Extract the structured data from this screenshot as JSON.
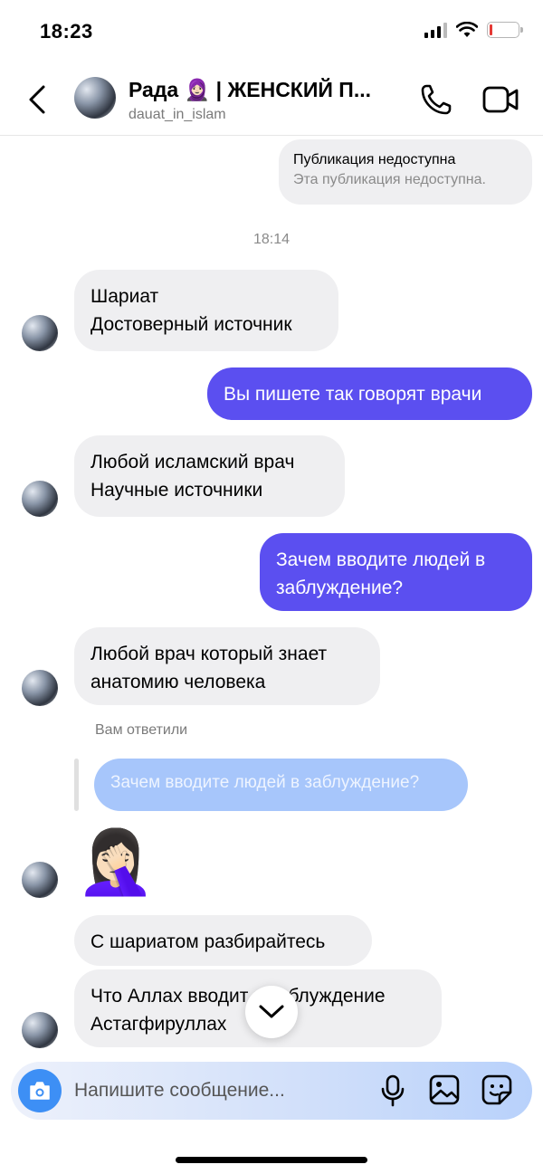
{
  "status_bar": {
    "time": "18:23"
  },
  "header": {
    "title": "Рада 🧕🏻 | ЖЕНСКИЙ П...",
    "subtitle": "dauat_in_islam"
  },
  "messages": {
    "publication": {
      "title": "Публикация недоступна",
      "subtitle": "Эта публикация недоступна."
    },
    "timestamp": "18:14",
    "m1": {
      "line1": "Шариат",
      "line2": "Достоверный источник"
    },
    "m2": {
      "line1": "Вы пишете так говорят врачи"
    },
    "m3": {
      "line1": "Любой исламский врач",
      "line2": "Научные источники"
    },
    "m4": {
      "line1": "Зачем вводите людей в",
      "line2": "заблуждение?"
    },
    "m5": {
      "line1": "Любой врач который знает",
      "line2": "анатомию человека"
    },
    "reply_note": "Вам ответили",
    "reply_quote": "Зачем вводите людей в заблуждение?",
    "emoji": "🤦🏻‍♀️",
    "m6": {
      "line1": "С шариатом разбирайтесь"
    },
    "m7": {
      "line1": "Что Аллах вводит в заблуждение",
      "line2": "Астагфируллах"
    }
  },
  "composer": {
    "placeholder": "Напишите сообщение..."
  },
  "colors": {
    "outgoing": "#5b4ff0",
    "incoming": "#efeff1",
    "reply_quote": "#a7c6fb",
    "camera": "#3d8ff5"
  }
}
